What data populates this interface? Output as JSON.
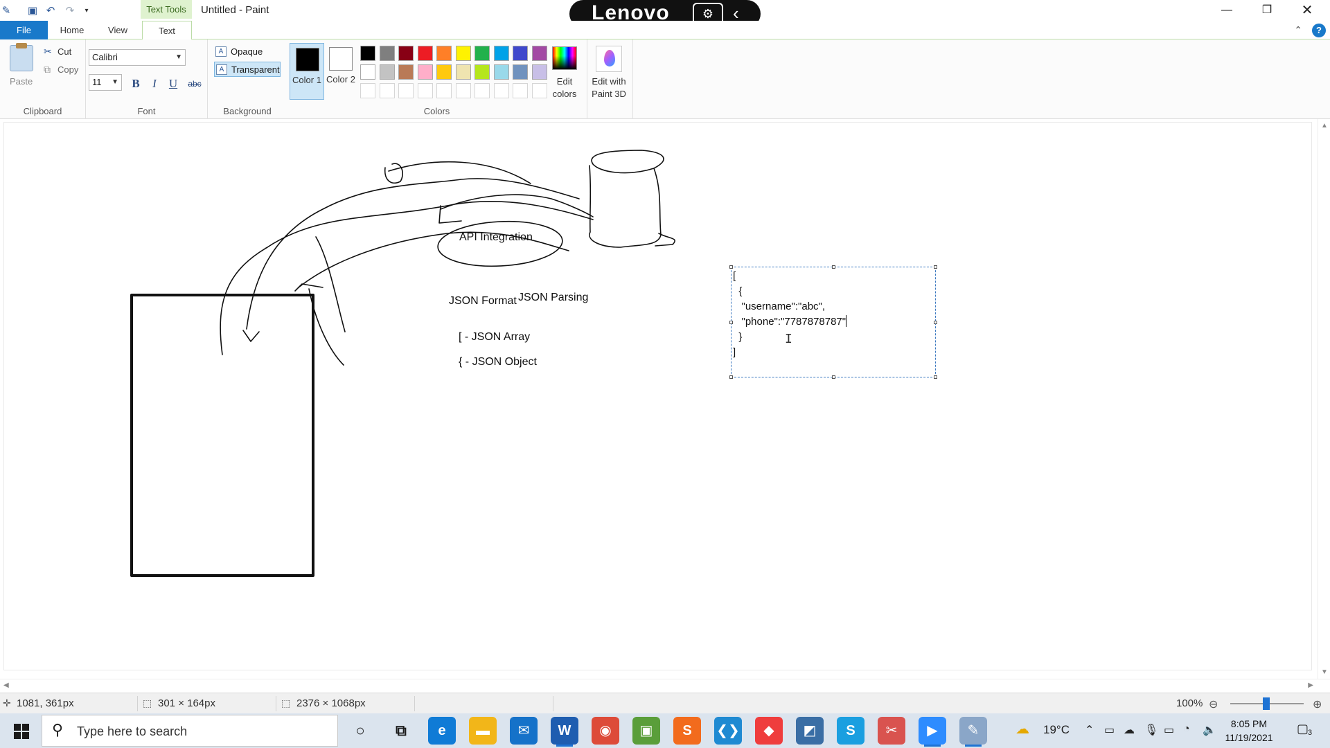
{
  "window": {
    "context_tab": "Text Tools",
    "title": "Untitled - Paint",
    "overlay_brand": "Lenovo"
  },
  "tabs": [
    "File",
    "Home",
    "View",
    "Text"
  ],
  "ribbon": {
    "clipboard": {
      "paste": "Paste",
      "cut": "Cut",
      "copy": "Copy",
      "group_label": "Clipboard"
    },
    "font": {
      "family": "Calibri",
      "size": "11",
      "bold": "B",
      "italic": "I",
      "underline": "U",
      "strike": "abc",
      "group_label": "Font"
    },
    "background": {
      "opaque": "Opaque",
      "transparent": "Transparent",
      "selected": "Transparent",
      "group_label": "Background"
    },
    "colors": {
      "color1_label": "Color 1",
      "color2_label": "Color 2",
      "color1_value": "#000000",
      "color2_value": "#ffffff",
      "palette_row1": [
        "#000000",
        "#7f7f7f",
        "#880015",
        "#ed1c24",
        "#ff7f27",
        "#fff200",
        "#22b14c",
        "#00a2e8",
        "#3f48cc",
        "#a349a4"
      ],
      "palette_row2": [
        "#ffffff",
        "#c3c3c3",
        "#b97a57",
        "#ffaec9",
        "#ffc90e",
        "#efe4b0",
        "#b5e61d",
        "#99d9ea",
        "#7092be",
        "#c8bfe7"
      ],
      "edit_colors": "Edit colors",
      "group_label": "Colors"
    },
    "paint3d": {
      "label": "Edit with Paint 3D"
    }
  },
  "canvas": {
    "labels": {
      "api": "API Integration",
      "json_format": "JSON Format",
      "json_parsing": "JSON Parsing",
      "array_note": "[ - JSON Array",
      "object_note": "{ - JSON Object"
    },
    "textbox_lines": [
      "[",
      "  {",
      "   \"username\":\"abc\",",
      "   \"phone\":\"7787878787\"",
      "  }",
      "]"
    ]
  },
  "statusbar": {
    "cursor_pos": "1081, 361px",
    "selection_size": "301 × 164px",
    "image_size": "2376 × 1068px",
    "zoom": "100%"
  },
  "taskbar": {
    "search_placeholder": "Type here to search",
    "weather": "19°C",
    "time": "8:05 PM",
    "date": "11/19/2021",
    "notification_count": "3",
    "apps": [
      {
        "name": "cortana",
        "color": "#1a1a1a"
      },
      {
        "name": "task-view",
        "color": "#1a1a1a"
      },
      {
        "name": "edge",
        "color": "#0f7bd6"
      },
      {
        "name": "file-explorer",
        "color": "#f2b619"
      },
      {
        "name": "mail",
        "color": "#1572c9"
      },
      {
        "name": "word",
        "color": "#1e5db0"
      },
      {
        "name": "chrome",
        "color": "#dd4b39"
      },
      {
        "name": "photos",
        "color": "#5a9e3a"
      },
      {
        "name": "sublime",
        "color": "#f26b1d"
      },
      {
        "name": "vscode",
        "color": "#1f8ad2"
      },
      {
        "name": "anydesk",
        "color": "#ef3d3d"
      },
      {
        "name": "mysql-workbench",
        "color": "#3a6ea5"
      },
      {
        "name": "skype",
        "color": "#1a9fe0"
      },
      {
        "name": "snip-sketch",
        "color": "#d9534f"
      },
      {
        "name": "zoom",
        "color": "#2d8cff"
      },
      {
        "name": "paint",
        "color": "#8aa6c8"
      }
    ]
  }
}
